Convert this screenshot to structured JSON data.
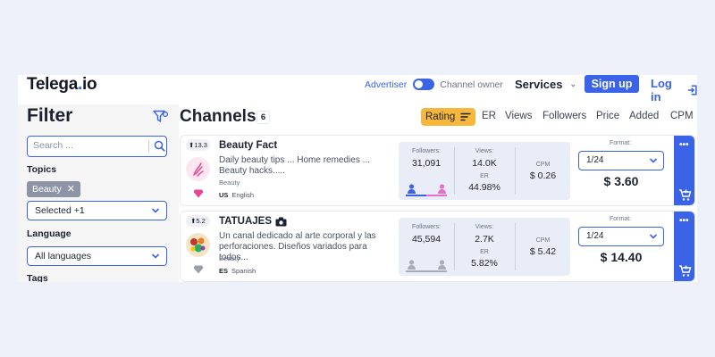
{
  "header": {
    "logo_main": "Telega",
    "logo_dot": ".",
    "logo_tld": "io",
    "role_advertiser": "Advertiser",
    "role_channel_owner": "Channel owner",
    "services": "Services",
    "sign_up": "Sign up",
    "log_in": "Log in"
  },
  "filter": {
    "title": "Filter",
    "search_placeholder": "Search ...",
    "topics_label": "Topics",
    "topic_chip": "Beauty",
    "topics_select": "Selected +1",
    "language_label": "Language",
    "language_select": "All languages",
    "tags_label": "Tags"
  },
  "channels": {
    "title": "Channels",
    "count": "6",
    "sort_active": "Rating",
    "sort_options": [
      "ER",
      "Views",
      "Followers",
      "Price",
      "Added",
      "CPM"
    ]
  },
  "cards": [
    {
      "rank": "13.3",
      "name": "Beauty Fact",
      "description": "Daily beauty tips ... Home remedies ... Beauty hacks.....",
      "category": "Beauty",
      "lang_code": "US",
      "lang_name": "English",
      "followers_label": "Followers:",
      "followers": "31,091",
      "views_label": "Views:",
      "views": "14.0K",
      "er_label": "ER",
      "er": "44.98%",
      "cpm_label": "CPM",
      "cpm": "$ 0.26",
      "format_label": "Format:",
      "format": "1/24",
      "price": "$ 3.60",
      "male_share": 0.5,
      "gem_color": "#e8458f"
    },
    {
      "rank": "5.2",
      "name": "TATUAJES",
      "description": "Un canal dedicado al arte corporal y las perforaciones. Diseños variados para todos...",
      "category": "Beauty",
      "lang_code": "ES",
      "lang_name": "Spanish",
      "followers_label": "Followers:",
      "followers": "45,594",
      "views_label": "Views:",
      "views": "2.7K",
      "er_label": "ER",
      "er": "5.82%",
      "cpm_label": "CPM",
      "cpm": "$ 5.42",
      "format_label": "Format:",
      "format": "1/24",
      "price": "$ 14.40",
      "male_share": 0.5,
      "gem_color": "#9a9fab"
    }
  ],
  "colors": {
    "accent": "#3a63e8",
    "rating_sort": "#f6b73c",
    "male_bar": "#3a63e8",
    "female_bar": "#e86fc8",
    "unknown_bar": "#a7acb8"
  }
}
